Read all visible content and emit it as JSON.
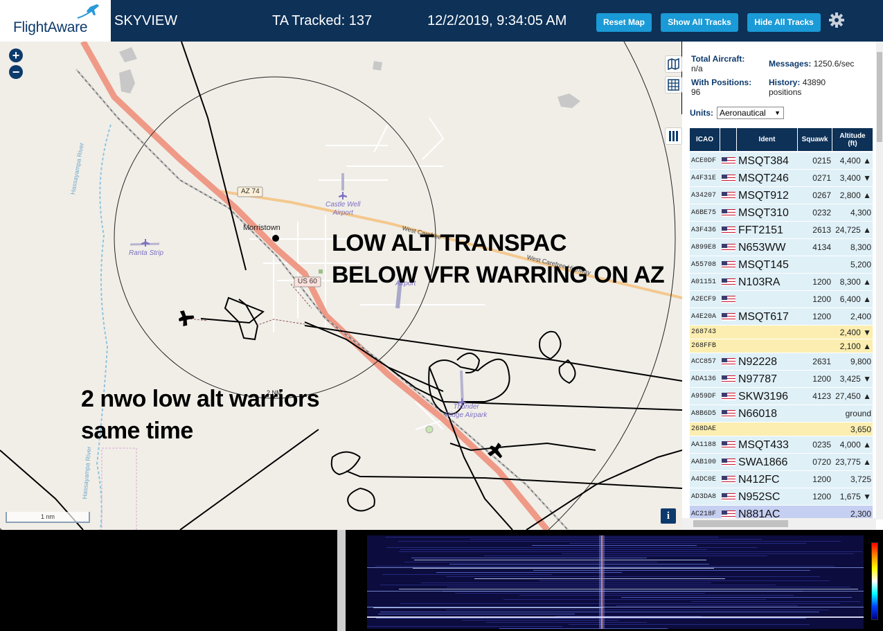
{
  "header": {
    "logo": "FlightAware",
    "title": "SKYVIEW",
    "tracked": "TA Tracked: 137",
    "datetime": "12/2/2019, 9:34:05 AM",
    "buttons": {
      "reset": "Reset Map",
      "show": "Show All Tracks",
      "hide": "Hide All Tracks"
    }
  },
  "map": {
    "zoom_in": "+",
    "zoom_out": "−",
    "places": {
      "castle_well": "Castle Well\nAirport",
      "ranta": "Ranta Strip",
      "morristown": "Morristown",
      "az74": "AZ 74",
      "us60": "US 60",
      "carefree1": "West Carefree",
      "carefree2": "West Carefree Highway",
      "hassayampa1": "Hassayampa River",
      "hassayampa2": "Hassayampa River",
      "thunder": "Thunder\nRidge Airpark",
      "airport": "Airport",
      "ring": "2 NM"
    },
    "annotations": {
      "line1": "LOW ALT TRANSPAC",
      "line2": "BELOW VFR WARRING ON AZ",
      "line3": "2 nwo low alt warriors",
      "line4": "same time"
    },
    "scale": "1 nm",
    "info": "i"
  },
  "panel": {
    "total_aircraft_label": "Total Aircraft:",
    "total_aircraft_value": "n/a",
    "messages_label": "Messages:",
    "messages_value": "1250.6/sec",
    "with_positions_label": "With Positions:",
    "with_positions_value": "96",
    "history_label": "History:",
    "history_value": "43890",
    "history_unit": "positions",
    "units_label": "Units:",
    "units_value": "Aeronautical",
    "columns": [
      "ICAO",
      "",
      "Ident",
      "Squawk",
      "Altitude\n(ft)"
    ],
    "rows": [
      {
        "icao": "ACE0DF",
        "flag": true,
        "ident": "MSQT384",
        "squawk": "0215",
        "alt": "4,400 ▲",
        "type": "std"
      },
      {
        "icao": "A4F31E",
        "flag": true,
        "ident": "MSQT246",
        "squawk": "0271",
        "alt": "3,400 ▼",
        "type": "std"
      },
      {
        "icao": "A34207",
        "flag": true,
        "ident": "MSQT912",
        "squawk": "0267",
        "alt": "2,800 ▲",
        "type": "std"
      },
      {
        "icao": "A6BE75",
        "flag": true,
        "ident": "MSQT310",
        "squawk": "0232",
        "alt": "4,300",
        "type": "std"
      },
      {
        "icao": "A3F436",
        "flag": true,
        "ident": "FFT2151",
        "squawk": "2613",
        "alt": "24,725 ▲",
        "type": "std"
      },
      {
        "icao": "A899E8",
        "flag": true,
        "ident": "N653WW",
        "squawk": "4134",
        "alt": "8,300",
        "type": "std"
      },
      {
        "icao": "A55708",
        "flag": true,
        "ident": "MSQT145",
        "squawk": "",
        "alt": "5,200",
        "type": "std"
      },
      {
        "icao": "A01151",
        "flag": true,
        "ident": "N103RA",
        "squawk": "1200",
        "alt": "8,300 ▲",
        "type": "std"
      },
      {
        "icao": "A2ECF9",
        "flag": true,
        "ident": "",
        "squawk": "1200",
        "alt": "6,400 ▲",
        "type": "std"
      },
      {
        "icao": "A4E20A",
        "flag": true,
        "ident": "MSQT617",
        "squawk": "1200",
        "alt": "2,400",
        "type": "std"
      },
      {
        "icao": "268743",
        "flag": false,
        "ident": "",
        "squawk": "",
        "alt": "2,400 ▼",
        "type": "tisb"
      },
      {
        "icao": "268FFB",
        "flag": false,
        "ident": "",
        "squawk": "",
        "alt": "2,100 ▲",
        "type": "tisb"
      },
      {
        "icao": "ACC857",
        "flag": true,
        "ident": "N92228",
        "squawk": "2631",
        "alt": "9,800",
        "type": "std"
      },
      {
        "icao": "ADA136",
        "flag": true,
        "ident": "N97787",
        "squawk": "1200",
        "alt": "3,425 ▼",
        "type": "std"
      },
      {
        "icao": "A959DF",
        "flag": true,
        "ident": "SKW3196",
        "squawk": "4123",
        "alt": "27,450 ▲",
        "type": "std"
      },
      {
        "icao": "A8B6D5",
        "flag": true,
        "ident": "N66018",
        "squawk": "",
        "alt": "ground",
        "type": "std"
      },
      {
        "icao": "268DAE",
        "flag": false,
        "ident": "",
        "squawk": "",
        "alt": "3,650",
        "type": "tisb"
      },
      {
        "icao": "AA1188",
        "flag": true,
        "ident": "MSQT433",
        "squawk": "0235",
        "alt": "4,000 ▲",
        "type": "std"
      },
      {
        "icao": "AAB100",
        "flag": true,
        "ident": "SWA1866",
        "squawk": "0720",
        "alt": "23,775 ▲",
        "type": "std"
      },
      {
        "icao": "A4DC0E",
        "flag": true,
        "ident": "N412FC",
        "squawk": "1200",
        "alt": "3,725",
        "type": "std"
      },
      {
        "icao": "AD3DA8",
        "flag": true,
        "ident": "N952SC",
        "squawk": "1200",
        "alt": "1,675 ▼",
        "type": "std"
      },
      {
        "icao": "AC218F",
        "flag": true,
        "ident": "N881AC",
        "squawk": "",
        "alt": "2,300",
        "type": "sel"
      }
    ]
  },
  "colors": {
    "header_bg": "#0d3157",
    "button_bg": "#1a9ad6",
    "row_bg": "#dff0f7",
    "tisb_row_bg": "#fbeeb0",
    "selected_row_bg": "#c5cff2",
    "highway": "#ef9a87"
  }
}
